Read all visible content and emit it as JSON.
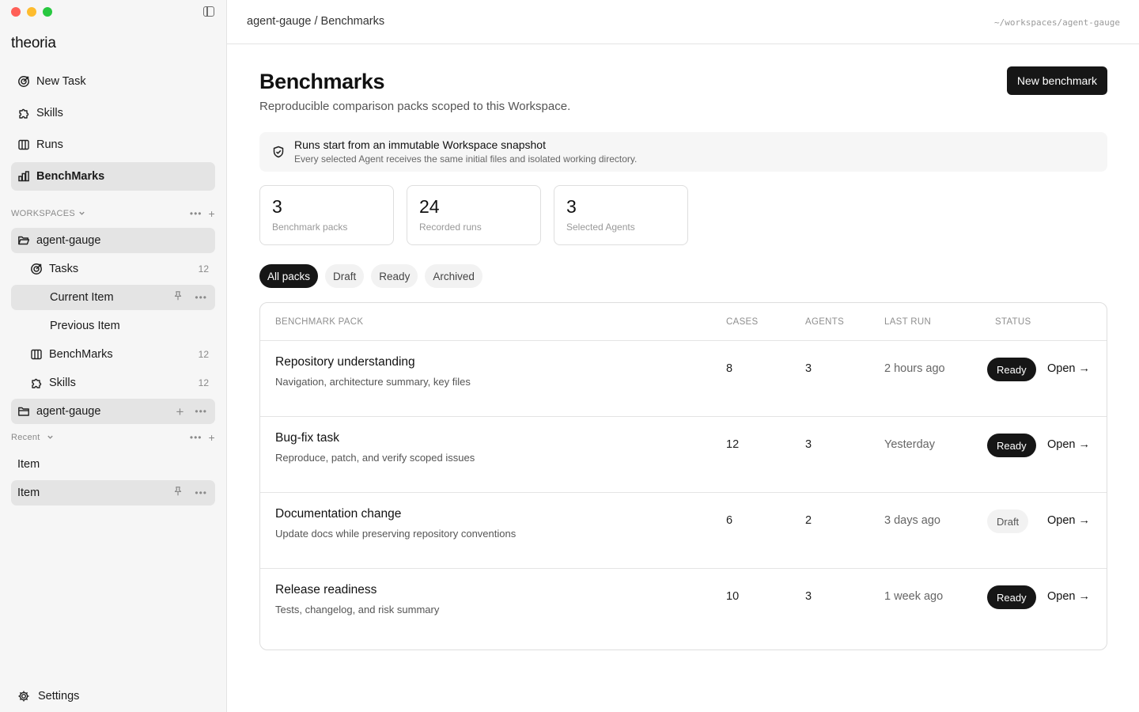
{
  "app": {
    "brand": "theoria",
    "window_buttons": {
      "close": "#ff5f57",
      "minimize": "#febc2e",
      "zoom": "#28c840"
    }
  },
  "sidebar": {
    "nav": [
      {
        "label": "New Task",
        "icon": "target-icon"
      },
      {
        "label": "Skills",
        "icon": "puzzle-icon"
      },
      {
        "label": "Runs",
        "icon": "columns-icon"
      },
      {
        "label": "BenchMarks",
        "icon": "bar-chart-icon",
        "active": true
      }
    ],
    "workspaces_label": "WORKSPACES",
    "workspace_1": {
      "name": "agent-gauge",
      "children": [
        {
          "label": "Tasks",
          "count": "12",
          "icon": "target-icon"
        },
        {
          "label": "Current Item"
        },
        {
          "label": "Previous Item"
        },
        {
          "label": "BenchMarks",
          "count": "12",
          "icon": "columns-icon"
        },
        {
          "label": "Skills",
          "count": "12",
          "icon": "puzzle-icon"
        }
      ]
    },
    "workspace_2": {
      "name": "agent-gauge"
    },
    "recent_label": "Recent",
    "recent": [
      {
        "label": "Item"
      },
      {
        "label": "Item"
      }
    ],
    "settings_label": "Settings"
  },
  "header": {
    "breadcrumb": "agent-gauge / Benchmarks",
    "path": "~/workspaces/agent-gauge"
  },
  "page": {
    "title": "Benchmarks",
    "subtitle": "Reproducible comparison packs scoped to this Workspace.",
    "new_button": "New benchmark"
  },
  "notice": {
    "title": "Runs start from an immutable Workspace snapshot",
    "description": "Every selected Agent receives the same initial files and isolated working directory.",
    "icon": "shield-check-icon"
  },
  "stats": [
    {
      "value": "3",
      "label": "Benchmark packs"
    },
    {
      "value": "24",
      "label": "Recorded runs"
    },
    {
      "value": "3",
      "label": "Selected Agents"
    }
  ],
  "filters": [
    {
      "label": "All packs",
      "active": true
    },
    {
      "label": "Draft"
    },
    {
      "label": "Ready"
    },
    {
      "label": "Archived"
    }
  ],
  "table": {
    "columns": [
      "BENCHMARK PACK",
      "CASES",
      "AGENTS",
      "LAST RUN",
      "STATUS"
    ],
    "rows": [
      {
        "name": "Repository understanding",
        "description": "Navigation, architecture summary, key files",
        "cases": "8",
        "agents": "3",
        "last_run": "2 hours ago",
        "status": "Ready",
        "action": "Open →"
      },
      {
        "name": "Bug-fix task",
        "description": "Reproduce, patch, and verify scoped issues",
        "cases": "12",
        "agents": "3",
        "last_run": "Yesterday",
        "status": "Ready",
        "action": "Open →"
      },
      {
        "name": "Documentation change",
        "description": "Update docs while preserving repository conventions",
        "cases": "6",
        "agents": "2",
        "last_run": "3 days ago",
        "status": "Draft",
        "action": "Open →"
      },
      {
        "name": "Release readiness",
        "description": "Tests, changelog, and risk summary",
        "cases": "10",
        "agents": "3",
        "last_run": "1 week ago",
        "status": "Ready",
        "action": "Open →"
      }
    ]
  }
}
